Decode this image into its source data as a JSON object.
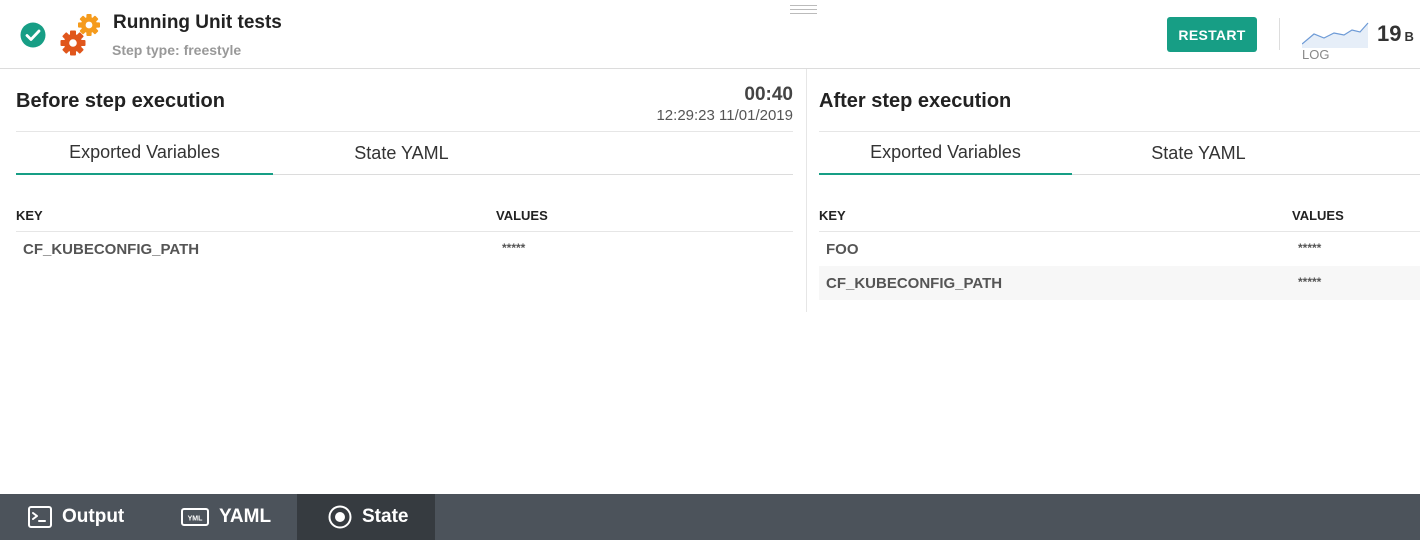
{
  "header": {
    "title": "Running Unit tests",
    "step_type": "Step type: freestyle",
    "restart_label": "RESTART",
    "log_label": "LOG",
    "log_size": "19",
    "log_unit": "B"
  },
  "before": {
    "title": "Before step execution",
    "duration": "00:40",
    "timestamp": "12:29:23 11/01/2019",
    "tabs": [
      {
        "label": "Exported Variables"
      },
      {
        "label": "State YAML"
      }
    ],
    "columns": {
      "key": "KEY",
      "values": "VALUES"
    },
    "rows": [
      {
        "key": "CF_KUBECONFIG_PATH",
        "value": "*****"
      }
    ]
  },
  "after": {
    "title": "After step execution",
    "tabs": [
      {
        "label": "Exported Variables"
      },
      {
        "label": "State YAML"
      }
    ],
    "columns": {
      "key": "KEY",
      "values": "VALUES"
    },
    "rows": [
      {
        "key": "FOO",
        "value": "*****"
      },
      {
        "key": "CF_KUBECONFIG_PATH",
        "value": "*****"
      }
    ]
  },
  "bottom_tabs": [
    {
      "label": "Output",
      "icon": "terminal-icon"
    },
    {
      "label": "YAML",
      "icon": "yaml-icon"
    },
    {
      "label": "State",
      "icon": "state-icon"
    }
  ],
  "colors": {
    "accent": "#179e85",
    "gear_orange": "#f59b1c",
    "gear_red": "#e0561c",
    "bottom_bar": "#4c535b",
    "bottom_bar_active": "#363b40"
  }
}
